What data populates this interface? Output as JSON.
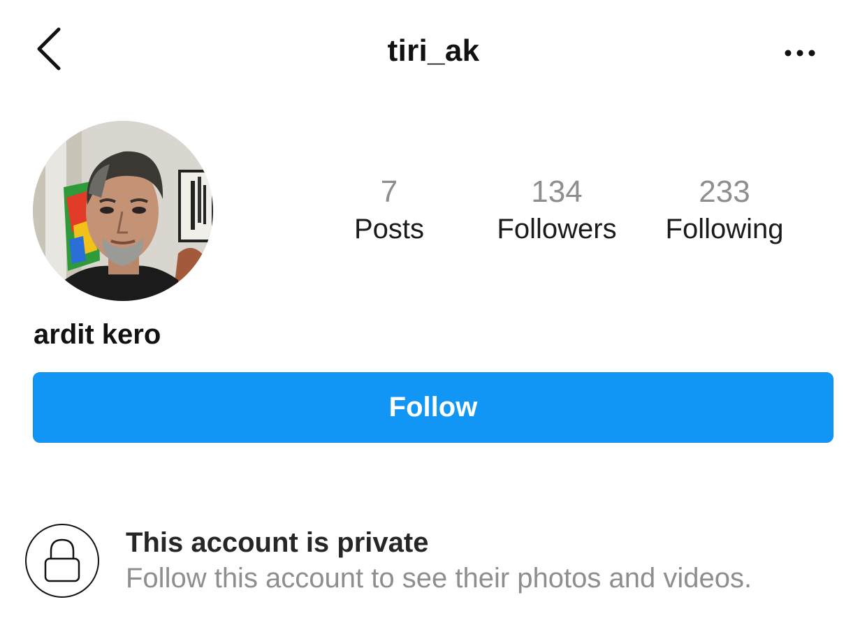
{
  "header": {
    "username": "tiri_ak",
    "back_icon": "chevron-left-icon",
    "more_icon": "more-horizontal-icon"
  },
  "profile": {
    "avatar": "profile-photo",
    "display_name": "ardit kero",
    "stats": {
      "posts": {
        "count": "7",
        "label": "Posts"
      },
      "followers": {
        "count": "134",
        "label": "Followers"
      },
      "following": {
        "count": "233",
        "label": "Following"
      }
    }
  },
  "actions": {
    "follow_label": "Follow",
    "follow_color": "#1296f5"
  },
  "private_notice": {
    "icon": "lock-icon",
    "title": "This account is private",
    "subtitle": "Follow this account to see their photos and videos."
  }
}
